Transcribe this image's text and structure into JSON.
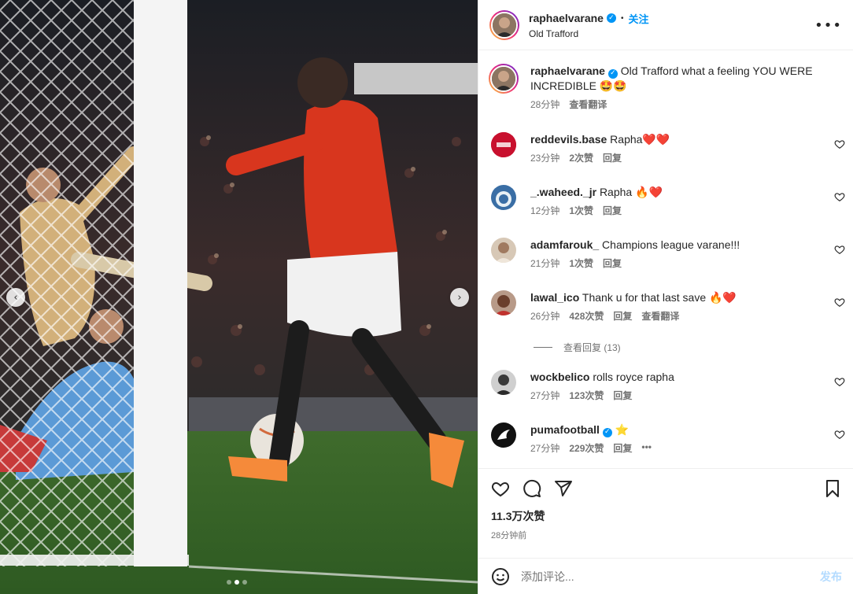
{
  "post": {
    "author": "raphaelvarane",
    "follow_label": "关注",
    "location": "Old Trafford",
    "caption_text": "Old Trafford what a feeling YOU WERE INCREDIBLE 🤩🤩",
    "caption_time": "28分钟",
    "caption_translate": "查看翻译",
    "likes": "11.3万次赞",
    "posted": "28分钟前",
    "comment_placeholder": "添加评论...",
    "post_button": "发布"
  },
  "carousel": {
    "total": 3,
    "active": 2
  },
  "comments": [
    {
      "user": "reddevils.base",
      "text": "Rapha❤️❤️",
      "time": "23分钟",
      "likes": "2次赞",
      "reply": "回复",
      "translate": "",
      "avatar_color": "#c8102e"
    },
    {
      "user": "_.waheed._jr",
      "text": "Rapha 🔥❤️",
      "time": "12分钟",
      "likes": "1次赞",
      "reply": "回复",
      "translate": "",
      "avatar_color": "#3a6ea5"
    },
    {
      "user": "adamfarouk_",
      "text": "Champions league varane!!!",
      "time": "21分钟",
      "likes": "1次赞",
      "reply": "回复",
      "translate": "",
      "avatar_color": "#c9b6a0"
    },
    {
      "user": "lawal_ico",
      "text": "Thank u for that last save 🔥❤️",
      "time": "26分钟",
      "likes": "428次赞",
      "reply": "回复",
      "translate": "查看翻译",
      "avatar_color": "#7a4a3a"
    },
    {
      "user": "wockbelico",
      "text": "rolls royce rapha",
      "time": "27分钟",
      "likes": "123次赞",
      "reply": "回复",
      "translate": "",
      "avatar_color": "#5a5a5a"
    },
    {
      "user": "pumafootball",
      "text": "⭐",
      "time": "27分钟",
      "likes": "229次赞",
      "reply": "回复",
      "translate": "•••",
      "avatar_color": "#111111"
    }
  ],
  "view_replies": "查看回复 (13)",
  "colors": {
    "link": "#0095f6",
    "muted": "#737373",
    "text": "#262626",
    "post_disabled": "#b3dbff"
  }
}
